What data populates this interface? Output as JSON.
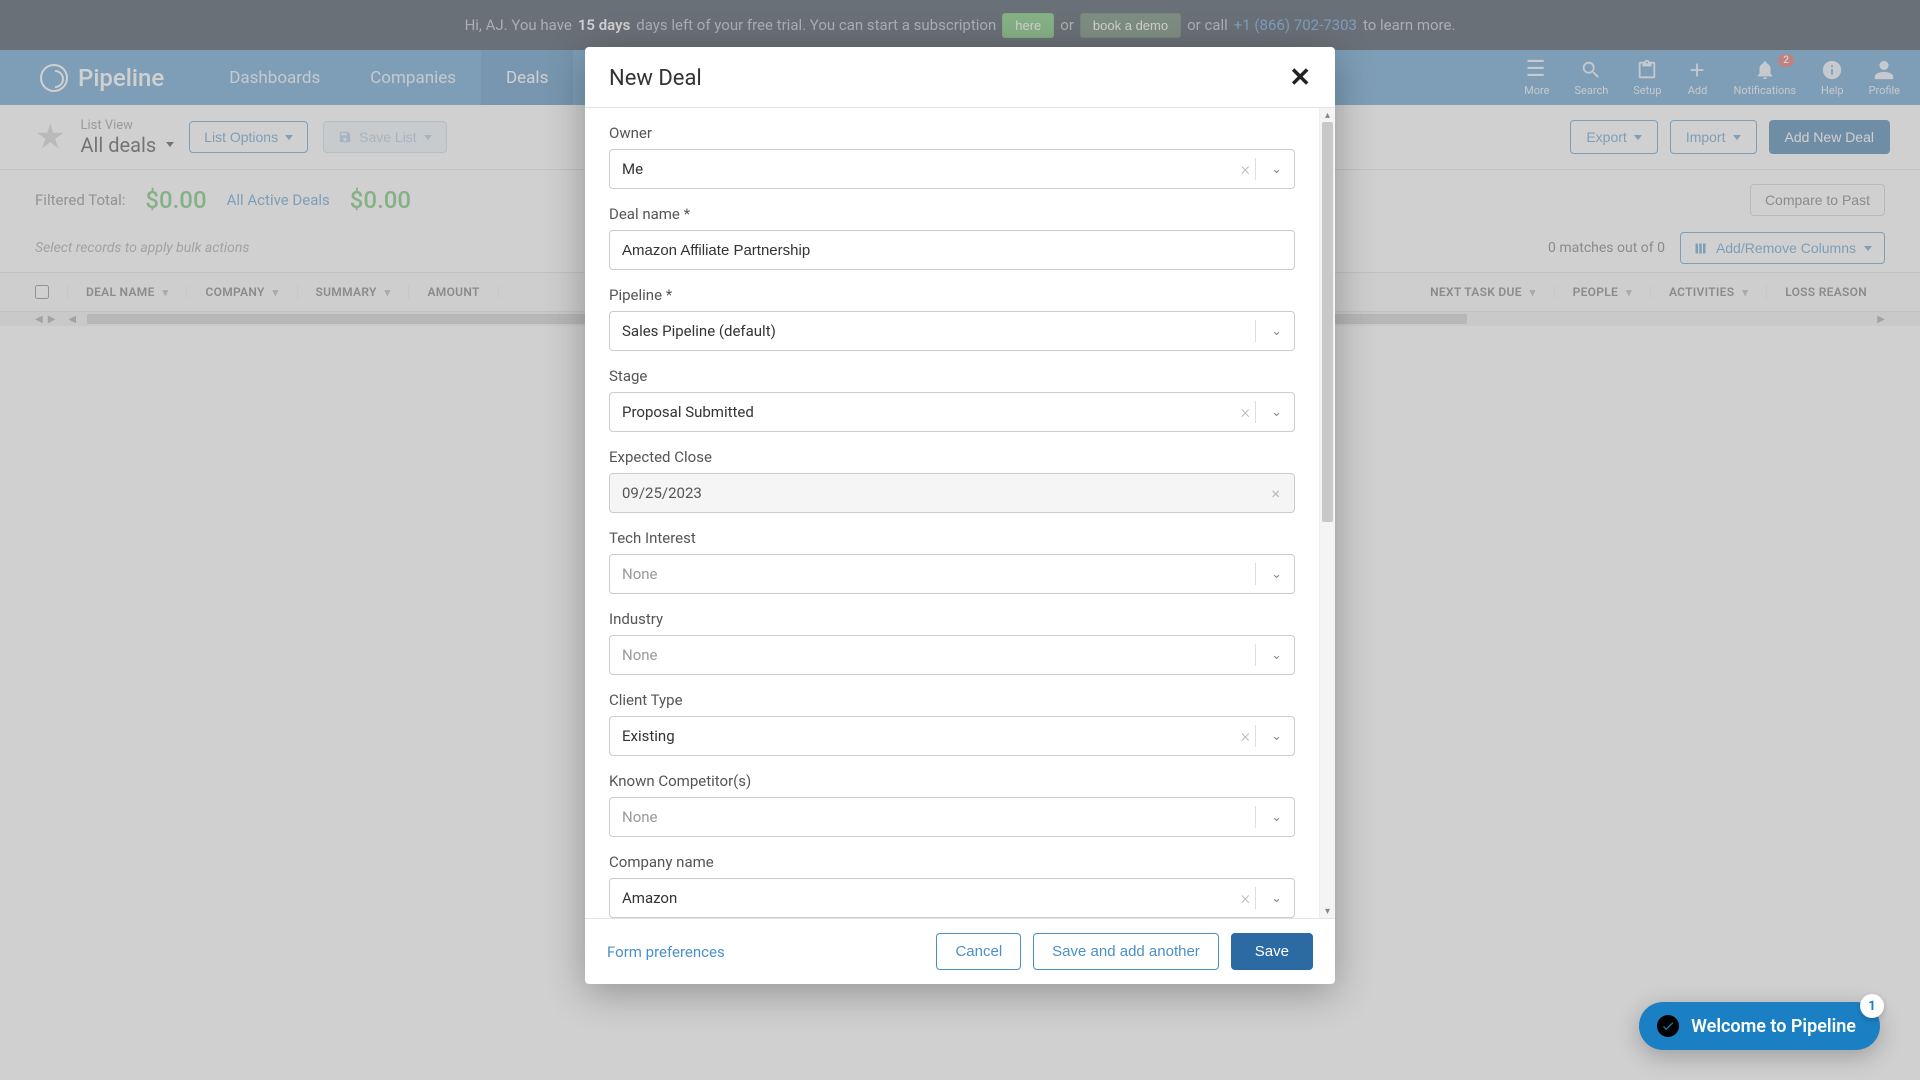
{
  "trial": {
    "prefix": "Hi, AJ. You have",
    "days": "15 days",
    "suffix": "days left of your free trial. You can start a subscription",
    "here": "here",
    "or": "or",
    "demo": "book a demo",
    "orcall": "or call",
    "phone": "+1 (866) 702-7303",
    "learn": "to learn more."
  },
  "brand": "Pipeline",
  "nav": {
    "dashboards": "Dashboards",
    "companies": "Companies",
    "deals": "Deals",
    "more": "More",
    "search": "Search",
    "setup": "Setup",
    "add": "Add",
    "notifications": "Notifications",
    "help": "Help",
    "profile": "Profile",
    "notif_count": "2"
  },
  "listbar": {
    "listview": "List View",
    "alldeals": "All deals",
    "list_options": "List Options",
    "save_list": "Save List",
    "export": "Export",
    "import": "Import",
    "add_new_deal": "Add New Deal"
  },
  "totals": {
    "filtered_label": "Filtered Total:",
    "filtered_amt": "$0.00",
    "active_label": "All Active Deals",
    "active_amt": "$0.00"
  },
  "bulk": {
    "hint": "Select records to apply bulk actions",
    "matches": "0 matches out of 0",
    "addcols": "Add/Remove Columns"
  },
  "columns": {
    "deal_name": "DEAL NAME",
    "company": "COMPANY",
    "summary": "SUMMARY",
    "amount": "AMOUNT",
    "next_task_due": "NEXT TASK DUE",
    "people": "PEOPLE",
    "activities": "ACTIVITIES",
    "loss": "LOSS REASON"
  },
  "modal": {
    "title": "New Deal",
    "labels": {
      "owner": "Owner",
      "deal_name": "Deal name *",
      "pipeline": "Pipeline *",
      "stage": "Stage",
      "expected_close": "Expected Close",
      "tech_interest": "Tech Interest",
      "industry": "Industry",
      "client_type": "Client Type",
      "known_competitors": "Known Competitor(s)",
      "company_name": "Company name"
    },
    "values": {
      "owner": "Me",
      "deal_name": "Amazon Affiliate Partnership",
      "pipeline": "Sales Pipeline (default)",
      "stage": "Proposal Submitted",
      "expected_close": "09/25/2023",
      "tech_interest": "None",
      "industry": "None",
      "client_type": "Existing",
      "known_competitors": "None",
      "company_name": "Amazon"
    },
    "footer": {
      "prefs": "Form preferences",
      "cancel": "Cancel",
      "save_another": "Save and add another",
      "save": "Save"
    }
  },
  "welcome": {
    "text": "Welcome to Pipeline",
    "badge": "1"
  },
  "compare": "Compare to Past"
}
